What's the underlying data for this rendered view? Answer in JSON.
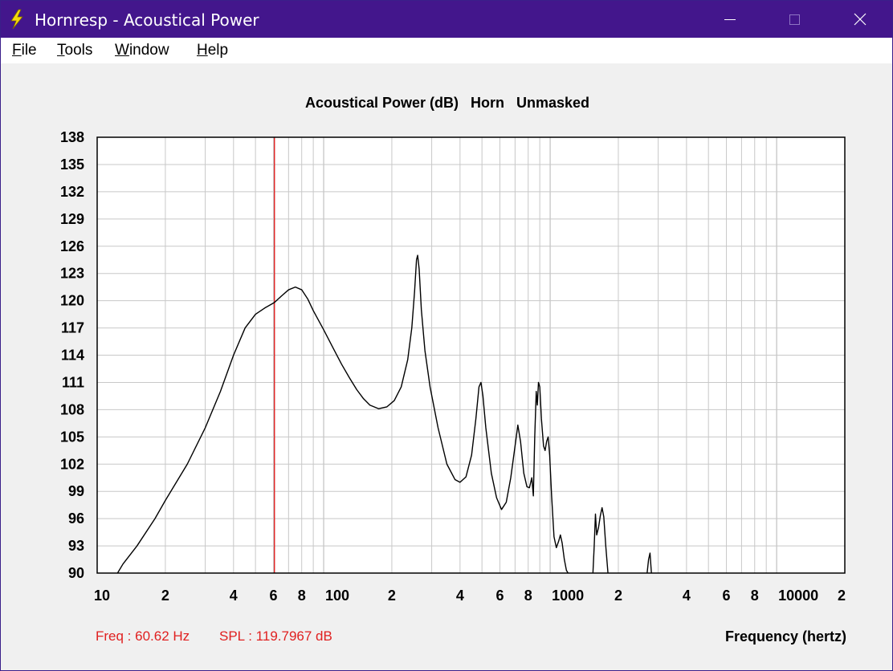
{
  "window": {
    "title": "Hornresp - Acoustical Power"
  },
  "menu": {
    "items": [
      "File",
      "Tools",
      "Window",
      "Help"
    ]
  },
  "status": {
    "freq": "Freq : 60.62 Hz",
    "spl": "SPL : 119.7967 dB"
  },
  "colors": {
    "titlebar": "#43168c",
    "curve": "#000000",
    "cursor": "#e02020",
    "grid": "#c8c8c8",
    "status": "#e02020"
  },
  "chart_data": {
    "type": "line",
    "title": "Acoustical Power (dB)   Horn   Unmasked",
    "xlabel": "Frequency (hertz)",
    "ylabel": "",
    "x_scale": "log",
    "xlim": [
      10,
      20000
    ],
    "ylim": [
      90,
      138
    ],
    "y_ticks": [
      90,
      93,
      96,
      99,
      102,
      105,
      108,
      111,
      114,
      117,
      120,
      123,
      126,
      129,
      132,
      135,
      138
    ],
    "x_tick_labels": [
      {
        "x": 10,
        "label": "10"
      },
      {
        "x": 20,
        "label": "2"
      },
      {
        "x": 40,
        "label": "4"
      },
      {
        "x": 60,
        "label": "6"
      },
      {
        "x": 80,
        "label": "8"
      },
      {
        "x": 100,
        "label": "100"
      },
      {
        "x": 200,
        "label": "2"
      },
      {
        "x": 400,
        "label": "4"
      },
      {
        "x": 600,
        "label": "6"
      },
      {
        "x": 800,
        "label": "8"
      },
      {
        "x": 1000,
        "label": "1000"
      },
      {
        "x": 2000,
        "label": "2"
      },
      {
        "x": 4000,
        "label": "4"
      },
      {
        "x": 6000,
        "label": "6"
      },
      {
        "x": 8000,
        "label": "8"
      },
      {
        "x": 10000,
        "label": "10000"
      },
      {
        "x": 20000,
        "label": "2"
      }
    ],
    "grid": true,
    "cursor_x": 60.62,
    "series": [
      {
        "points": [
          [
            12.3,
            90
          ],
          [
            13,
            91
          ],
          [
            15,
            93
          ],
          [
            18,
            96
          ],
          [
            20,
            98
          ],
          [
            25,
            102
          ],
          [
            30,
            106
          ],
          [
            35,
            110
          ],
          [
            40,
            114
          ],
          [
            45,
            117
          ],
          [
            50,
            118.5
          ],
          [
            55,
            119.2
          ],
          [
            60.62,
            119.8
          ],
          [
            65,
            120.5
          ],
          [
            70,
            121.2
          ],
          [
            75,
            121.5
          ],
          [
            80,
            121.2
          ],
          [
            85,
            120.2
          ],
          [
            90,
            118.9
          ],
          [
            100,
            116.8
          ],
          [
            110,
            114.8
          ],
          [
            120,
            113
          ],
          [
            130,
            111.5
          ],
          [
            140,
            110.2
          ],
          [
            150,
            109.2
          ],
          [
            160,
            108.5
          ],
          [
            175,
            108.1
          ],
          [
            190,
            108.3
          ],
          [
            205,
            109
          ],
          [
            220,
            110.5
          ],
          [
            235,
            113.5
          ],
          [
            245,
            117
          ],
          [
            252,
            121
          ],
          [
            257,
            124.5
          ],
          [
            260,
            125
          ],
          [
            264,
            123.5
          ],
          [
            270,
            119
          ],
          [
            280,
            114.5
          ],
          [
            295,
            110.5
          ],
          [
            320,
            106
          ],
          [
            350,
            102
          ],
          [
            380,
            100.3
          ],
          [
            400,
            100
          ],
          [
            425,
            100.6
          ],
          [
            450,
            103
          ],
          [
            470,
            107
          ],
          [
            485,
            110.5
          ],
          [
            495,
            111
          ],
          [
            505,
            109.5
          ],
          [
            520,
            106
          ],
          [
            550,
            101
          ],
          [
            580,
            98.3
          ],
          [
            610,
            97
          ],
          [
            640,
            97.8
          ],
          [
            670,
            100.5
          ],
          [
            700,
            104
          ],
          [
            720,
            106.3
          ],
          [
            740,
            104.5
          ],
          [
            765,
            101
          ],
          [
            790,
            99.5
          ],
          [
            810,
            99.4
          ],
          [
            830,
            100.5
          ],
          [
            843,
            98.5
          ],
          [
            855,
            105
          ],
          [
            868,
            110
          ],
          [
            878,
            108.5
          ],
          [
            888,
            111
          ],
          [
            900,
            110.5
          ],
          [
            915,
            107
          ],
          [
            935,
            104
          ],
          [
            950,
            103.5
          ],
          [
            965,
            104.5
          ],
          [
            980,
            105
          ],
          [
            995,
            103
          ],
          [
            1015,
            98.5
          ],
          [
            1040,
            94
          ],
          [
            1065,
            92.8
          ],
          [
            1090,
            93.5
          ],
          [
            1110,
            94.2
          ],
          [
            1130,
            93.3
          ],
          [
            1155,
            91.5
          ],
          [
            1180,
            90.3
          ],
          [
            1200,
            90
          ],
          [
            1545,
            90
          ],
          [
            1565,
            93
          ],
          [
            1585,
            96.5
          ],
          [
            1605,
            94.2
          ],
          [
            1635,
            95
          ],
          [
            1665,
            96.3
          ],
          [
            1695,
            97.2
          ],
          [
            1725,
            96.2
          ],
          [
            1760,
            93
          ],
          [
            1800,
            90
          ],
          [
            2680,
            90
          ],
          [
            2720,
            91.5
          ],
          [
            2760,
            92.2
          ],
          [
            2800,
            90
          ]
        ]
      }
    ]
  }
}
